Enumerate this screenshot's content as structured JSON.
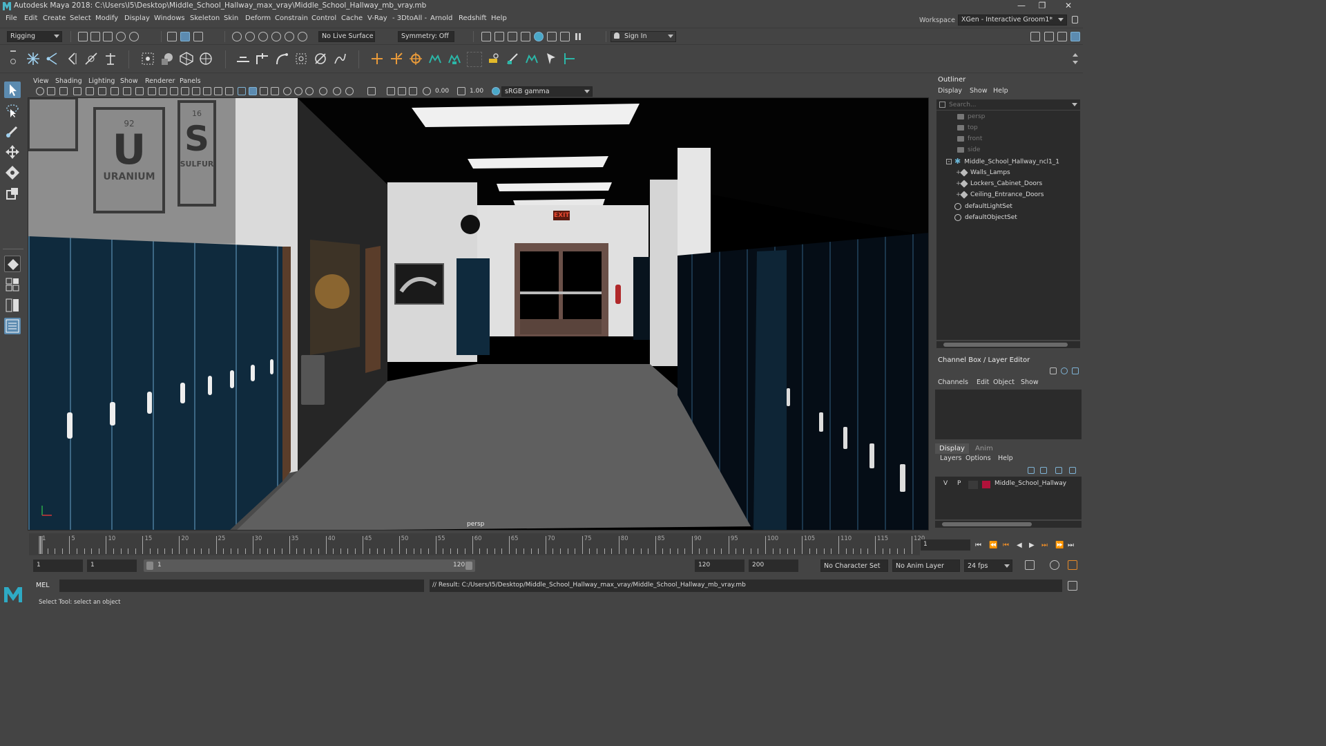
{
  "window": {
    "title": "Autodesk Maya 2018: C:\\Users\\I5\\Desktop\\Middle_School_Hallway_max_vray\\Middle_School_Hallway_mb_vray.mb",
    "minimize": "—",
    "maximize": "❐",
    "close": "✕"
  },
  "menubar": {
    "items": [
      "File",
      "Edit",
      "Create",
      "Select",
      "Modify",
      "Display",
      "Windows",
      "Skeleton",
      "Skin",
      "Deform",
      "Constrain",
      "Control",
      "Cache",
      "V-Ray",
      "- 3DtoAll -",
      "Arnold",
      "Redshift",
      "Help"
    ],
    "workspace_label": "Workspace :",
    "workspace_value": "XGen - Interactive Groom1*"
  },
  "statusline": {
    "menu_set": "Rigging",
    "live_surface": "No Live Surface",
    "symmetry": "Symmetry: Off",
    "sign_in": "Sign In"
  },
  "viewport": {
    "menu": [
      "View",
      "Shading",
      "Lighting",
      "Show",
      "Renderer",
      "Panels"
    ],
    "exposure": "0.00",
    "gamma": "1.00",
    "color_space": "sRGB gamma",
    "camera_label": "persp",
    "scene": {
      "element_symbol_1": "U",
      "element_name_1": "URANIUM",
      "element_number_1": "92",
      "element_symbol_2": "S",
      "element_name_2": "SULFUR",
      "element_number_2": "16",
      "exit_sign": "EXIT"
    }
  },
  "outliner": {
    "title": "Outliner",
    "menu": [
      "Display",
      "Show",
      "Help"
    ],
    "search_placeholder": "Search...",
    "items": [
      {
        "label": "persp",
        "dim": true
      },
      {
        "label": "top",
        "dim": true
      },
      {
        "label": "front",
        "dim": true
      },
      {
        "label": "side",
        "dim": true
      },
      {
        "label": "Middle_School_Hallway_ncl1_1",
        "dim": false
      },
      {
        "label": "Walls_Lamps",
        "dim": false
      },
      {
        "label": "Lockers_Cabinet_Doors",
        "dim": false
      },
      {
        "label": "Ceiling_Entrance_Doors",
        "dim": false
      },
      {
        "label": "defaultLightSet",
        "dim": false
      },
      {
        "label": "defaultObjectSet",
        "dim": false
      }
    ]
  },
  "channelbox": {
    "title": "Channel Box / Layer Editor",
    "menu": [
      "Channels",
      "Edit",
      "Object",
      "Show"
    ]
  },
  "layereditor": {
    "tabs": [
      "Display",
      "Anim"
    ],
    "menu": [
      "Layers",
      "Options",
      "Help"
    ],
    "layer": {
      "v": "V",
      "p": "P",
      "name": "Middle_School_Hallway",
      "color": "#b0123a"
    }
  },
  "timeline": {
    "ticks": [
      "1",
      "5",
      "10",
      "15",
      "20",
      "25",
      "30",
      "35",
      "40",
      "45",
      "50",
      "55",
      "60",
      "65",
      "70",
      "75",
      "80",
      "85",
      "90",
      "95",
      "100",
      "105",
      "110",
      "115",
      "120"
    ],
    "current_frame": "1"
  },
  "range": {
    "start_field": "1",
    "playback_start": "1",
    "slider_start": "1",
    "slider_end": "120",
    "playback_end": "120",
    "end_field": "200",
    "character_set": "No Character Set",
    "anim_layer": "No Anim Layer",
    "fps": "24 fps"
  },
  "commandline": {
    "label": "MEL",
    "result": "// Result: C:/Users/I5/Desktop/Middle_School_Hallway_max_vray/Middle_School_Hallway_mb_vray.mb"
  },
  "helpline": {
    "text": "Select Tool: select an object"
  },
  "colors": {
    "accent": "#5c8bb0",
    "locker": "#0f2a3d",
    "panel": "#444444",
    "field": "#2b2b2b"
  }
}
